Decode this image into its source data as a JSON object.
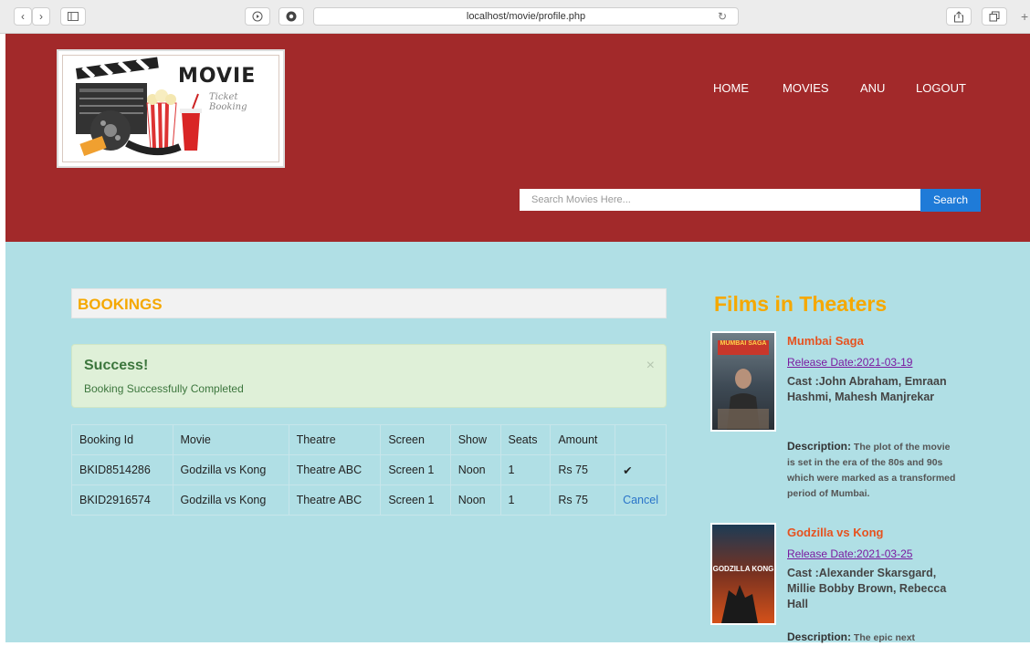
{
  "browser": {
    "url": "localhost/movie/profile.php"
  },
  "header": {
    "logo": {
      "title": "MOVIE",
      "subtitle": "Ticket Booking",
      "badge": "TICKET"
    },
    "nav": [
      {
        "label": "HOME"
      },
      {
        "label": "MOVIES"
      },
      {
        "label": "ANU"
      },
      {
        "label": "LOGOUT"
      }
    ],
    "search": {
      "placeholder": "Search Movies Here...",
      "button_label": "Search"
    }
  },
  "bookings": {
    "heading": "BOOKINGS",
    "alert": {
      "title": "Success!",
      "message": "Booking Successfully Completed",
      "close": "×"
    },
    "columns": [
      "Booking Id",
      "Movie",
      "Theatre",
      "Screen",
      "Show",
      "Seats",
      "Amount",
      ""
    ],
    "rows": [
      {
        "id": "BKID8514286",
        "movie": "Godzilla vs Kong",
        "theatre": "Theatre ABC",
        "screen": "Screen 1",
        "show": "Noon",
        "seats": "1",
        "amount": "Rs 75",
        "action": "✔"
      },
      {
        "id": "BKID2916574",
        "movie": "Godzilla vs Kong",
        "theatre": "Theatre ABC",
        "screen": "Screen 1",
        "show": "Noon",
        "seats": "1",
        "amount": "Rs 75",
        "action": "Cancel"
      }
    ]
  },
  "sidebar": {
    "title": "Films in Theaters",
    "films": [
      {
        "name": "Mumbai Saga",
        "release": "Release Date:2021-03-19",
        "cast": "Cast :John Abraham, Emraan Hashmi, Mahesh Manjrekar",
        "desc_label": "Description:",
        "desc": " The plot of the movie is set in the era of the 80s and 90s which were marked as a transformed period of Mumbai.",
        "poster_text": "MUMBAI SAGA"
      },
      {
        "name": "Godzilla vs Kong",
        "release": "Release Date:2021-03-25",
        "cast": "Cast :Alexander Skarsgard, Millie Bobby Brown, Rebecca Hall",
        "desc_label": "Description:",
        "desc": " The epic next",
        "poster_text": "GODZILLA KONG"
      }
    ]
  },
  "colors": {
    "header_bg": "#a2292a",
    "main_bg": "#b0dfe5",
    "accent_orange": "#f5a800",
    "search_blue": "#1f7bd8",
    "film_name": "#e6521f"
  }
}
